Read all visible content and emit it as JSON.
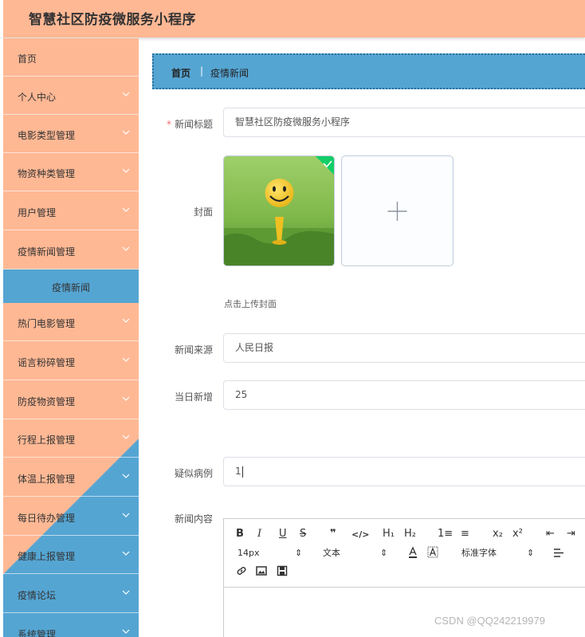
{
  "app": {
    "title": "智慧社区防疫微服务小程序"
  },
  "sidebar": {
    "items": [
      {
        "label": "首页",
        "chevron": false
      },
      {
        "label": "个人中心",
        "chevron": true
      },
      {
        "label": "电影类型管理",
        "chevron": true
      },
      {
        "label": "物资种类管理",
        "chevron": true
      },
      {
        "label": "用户管理",
        "chevron": true
      },
      {
        "label": "疫情新闻管理",
        "chevron": true
      },
      {
        "label": "热门电影管理",
        "chevron": true
      },
      {
        "label": "谣言粉碎管理",
        "chevron": true
      },
      {
        "label": "防疫物资管理",
        "chevron": true
      },
      {
        "label": "行程上报管理",
        "chevron": true
      },
      {
        "label": "体温上报管理",
        "chevron": true
      },
      {
        "label": "每日待办管理",
        "chevron": true
      },
      {
        "label": "健康上报管理",
        "chevron": true
      },
      {
        "label": "疫情论坛",
        "chevron": true
      },
      {
        "label": "系统管理",
        "chevron": true
      }
    ],
    "active_sub": {
      "label": "疫情新闻"
    }
  },
  "breadcrumb": {
    "home": "首页",
    "separator": "|",
    "current": "疫情新闻"
  },
  "form": {
    "title": {
      "label": "新闻标题",
      "required_mark": "*",
      "value": "智慧社区防疫微服务小程序"
    },
    "cover": {
      "label": "封面",
      "hint": "点击上传封面",
      "upload_glyph": "+"
    },
    "source": {
      "label": "新闻来源",
      "value": "人民日报"
    },
    "daily_new": {
      "label": "当日新增",
      "value": "25"
    },
    "suspected": {
      "label": "疑似病例",
      "value": "1"
    },
    "content": {
      "label": "新闻内容"
    }
  },
  "editor": {
    "buttons": {
      "bold": "B",
      "italic": "I",
      "underline": "U",
      "strike": "S",
      "quote": "❞",
      "code": "</>",
      "h1": "H₁",
      "h2": "H₂",
      "ordered_list": "1≡",
      "bullet_list": "≡",
      "sub": "x₂",
      "sup": "x²",
      "indent_left": "⇤",
      "indent_right": "⇥"
    },
    "font_size": "14px",
    "block_type": "文本",
    "font_family": "标准字体",
    "select_arrows": "⇕"
  },
  "watermark": "CSDN @QQ242219979",
  "colors": {
    "header": "#ffb894",
    "accent": "#55a5d3",
    "required": "#f56c6c"
  }
}
